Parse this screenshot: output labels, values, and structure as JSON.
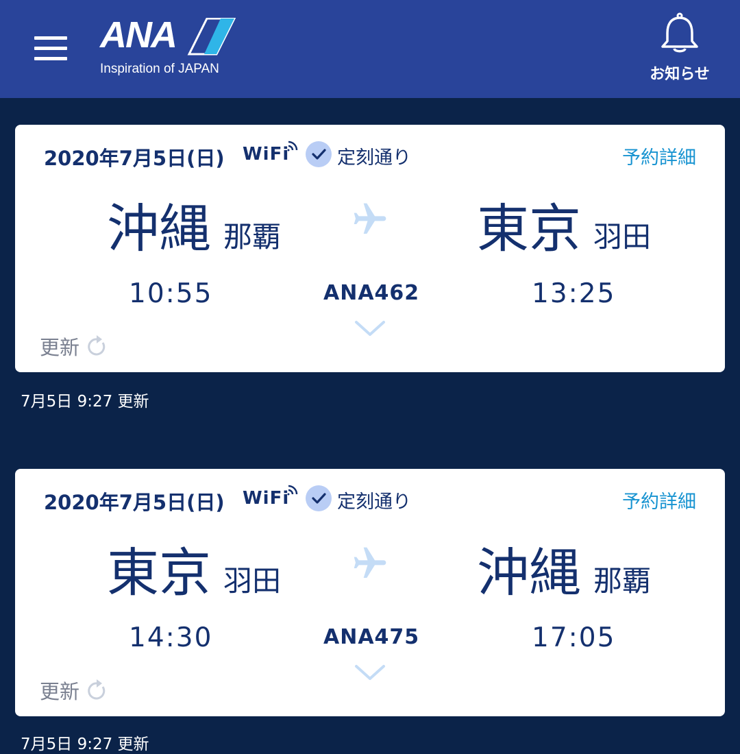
{
  "header": {
    "logo_text": "ANA",
    "logo_tagline": "Inspiration of JAPAN",
    "notice_label": "お知らせ",
    "menu_icon": "hamburger-menu-icon",
    "notice_icon": "bell-icon",
    "background_color": "#29449a"
  },
  "colors": {
    "page_background": "#0b2349",
    "card_background": "#ffffff",
    "text_primary": "#14306e",
    "link": "#1793d1",
    "plane_icon": "#c4dcf6",
    "status_check_bg": "#b9cdf5",
    "refresh_gray": "#7a8090"
  },
  "flights": [
    {
      "date": "2020年7月5日(日)",
      "wifi_label": "WiFi",
      "status": "定刻通り",
      "detail_link": "予約詳細",
      "origin_city": "沖縄",
      "origin_airport": "那覇",
      "destination_city": "東京",
      "destination_airport": "羽田",
      "departure_time": "10:55",
      "arrival_time": "13:25",
      "flight_number": "ANA462",
      "refresh_label": "更新",
      "updated_note": "7月5日 9:27 更新"
    },
    {
      "date": "2020年7月5日(日)",
      "wifi_label": "WiFi",
      "status": "定刻通り",
      "detail_link": "予約詳細",
      "origin_city": "東京",
      "origin_airport": "羽田",
      "destination_city": "沖縄",
      "destination_airport": "那覇",
      "departure_time": "14:30",
      "arrival_time": "17:05",
      "flight_number": "ANA475",
      "refresh_label": "更新",
      "updated_note": "7月5日 9:27 更新"
    }
  ]
}
